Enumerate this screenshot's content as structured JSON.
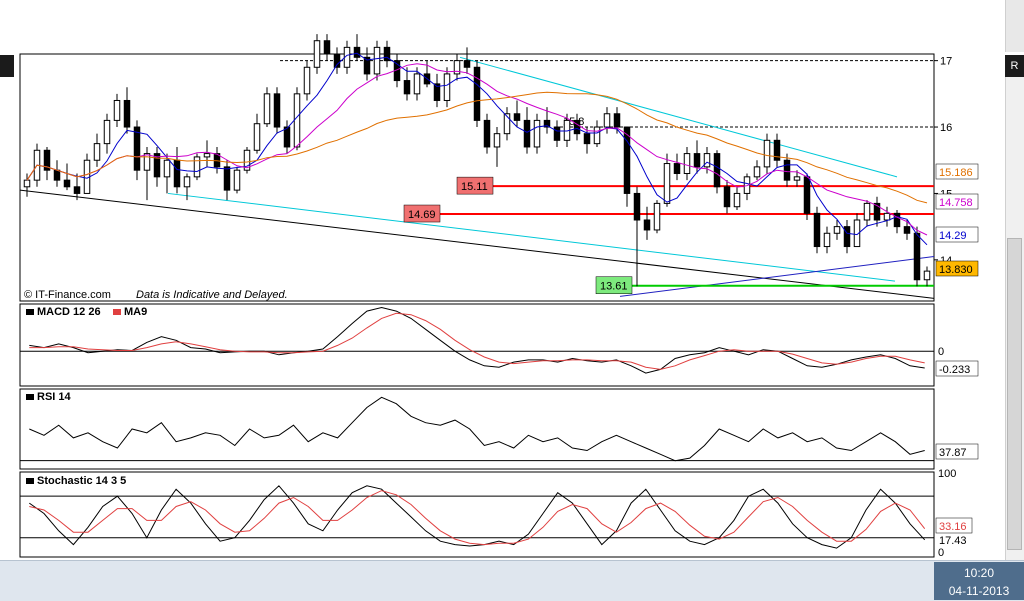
{
  "window": {
    "right_scroll_glyph": "R",
    "watermark": "© IT-Finance.com",
    "disclaimer": "Data is Indicative and Delayed."
  },
  "taskbar": {
    "time": "10:20",
    "date": "04-11-2013"
  },
  "colors": {
    "up_candle": "#ffffff",
    "down_candle": "#000000",
    "sma_fast": "#0000cc",
    "sma_mid": "#cc00cc",
    "sma_slow": "#e07000",
    "resistance": "#ff0000",
    "support": "#00cc00",
    "channel": "#00c8d8",
    "trendline": "#000000",
    "macd": "#000000",
    "macd_signal": "#e04040",
    "stoch_d": "#e04040"
  },
  "chart_data": [
    {
      "type": "candlestick",
      "ylim": [
        13.38,
        17.1
      ],
      "y_ticks": [
        "17",
        "16",
        "15",
        "14"
      ],
      "indicators": {
        "sma_fast": {
          "last": "14.29"
        },
        "sma_mid": {
          "last": "14.758"
        },
        "sma_slow": {
          "last": "15.186"
        }
      },
      "last_price": "13.830",
      "dotted_high_label": "15.8",
      "levels": [
        {
          "value": 15.11,
          "label": "15.11",
          "color": "#ff0000"
        },
        {
          "value": 14.69,
          "label": "14.69",
          "color": "#ff0000"
        },
        {
          "value": 13.61,
          "label": "13.61",
          "color": "#00cc00"
        }
      ],
      "ohlc": [
        [
          15.1,
          15.3,
          14.95,
          15.2
        ],
        [
          15.2,
          15.75,
          15.1,
          15.65
        ],
        [
          15.65,
          15.7,
          15.2,
          15.35
        ],
        [
          15.35,
          15.5,
          15.1,
          15.2
        ],
        [
          15.2,
          15.45,
          15.05,
          15.1
        ],
        [
          15.1,
          15.3,
          14.9,
          15.0
        ],
        [
          15.0,
          15.6,
          15.0,
          15.5
        ],
        [
          15.5,
          15.9,
          15.4,
          15.75
        ],
        [
          15.75,
          16.2,
          15.6,
          16.1
        ],
        [
          16.1,
          16.5,
          16.0,
          16.4
        ],
        [
          16.4,
          16.6,
          15.9,
          16.0
        ],
        [
          16.0,
          16.1,
          15.2,
          15.35
        ],
        [
          15.35,
          15.7,
          14.9,
          15.6
        ],
        [
          15.6,
          15.7,
          15.1,
          15.25
        ],
        [
          15.25,
          15.6,
          15.0,
          15.5
        ],
        [
          15.5,
          15.7,
          15.0,
          15.1
        ],
        [
          15.1,
          15.3,
          14.9,
          15.25
        ],
        [
          15.25,
          15.6,
          15.2,
          15.55
        ],
        [
          15.55,
          15.8,
          15.4,
          15.6
        ],
        [
          15.6,
          15.7,
          15.3,
          15.4
        ],
        [
          15.4,
          15.5,
          14.9,
          15.05
        ],
        [
          15.05,
          15.4,
          15.0,
          15.35
        ],
        [
          15.35,
          15.7,
          15.3,
          15.65
        ],
        [
          15.65,
          16.2,
          15.6,
          16.05
        ],
        [
          16.05,
          16.6,
          16.0,
          16.5
        ],
        [
          16.5,
          16.6,
          15.9,
          16.0
        ],
        [
          16.0,
          16.1,
          15.6,
          15.7
        ],
        [
          15.7,
          16.6,
          15.65,
          16.5
        ],
        [
          16.5,
          17.0,
          16.4,
          16.9
        ],
        [
          16.9,
          17.4,
          16.8,
          17.3
        ],
        [
          17.3,
          17.4,
          17.0,
          17.1
        ],
        [
          17.1,
          17.2,
          16.8,
          16.9
        ],
        [
          16.9,
          17.3,
          16.8,
          17.2
        ],
        [
          17.2,
          17.4,
          17.0,
          17.05
        ],
        [
          17.05,
          17.2,
          16.7,
          16.8
        ],
        [
          16.8,
          17.3,
          16.7,
          17.2
        ],
        [
          17.2,
          17.3,
          16.9,
          17.0
        ],
        [
          17.0,
          17.1,
          16.6,
          16.7
        ],
        [
          16.7,
          16.9,
          16.4,
          16.5
        ],
        [
          16.5,
          16.9,
          16.4,
          16.8
        ],
        [
          16.8,
          17.0,
          16.6,
          16.65
        ],
        [
          16.65,
          16.8,
          16.3,
          16.4
        ],
        [
          16.4,
          16.9,
          16.3,
          16.8
        ],
        [
          16.8,
          17.1,
          16.7,
          17.0
        ],
        [
          17.0,
          17.2,
          16.8,
          16.9
        ],
        [
          16.9,
          17.0,
          16.0,
          16.1
        ],
        [
          16.1,
          16.2,
          15.6,
          15.7
        ],
        [
          15.7,
          16.0,
          15.4,
          15.9
        ],
        [
          15.9,
          16.3,
          15.8,
          16.2
        ],
        [
          16.2,
          16.4,
          16.0,
          16.1
        ],
        [
          16.1,
          16.3,
          15.6,
          15.7
        ],
        [
          15.7,
          16.2,
          15.6,
          16.1
        ],
        [
          16.1,
          16.3,
          15.9,
          16.0
        ],
        [
          16.0,
          16.1,
          15.7,
          15.8
        ],
        [
          15.8,
          16.2,
          15.7,
          16.1
        ],
        [
          16.1,
          16.2,
          15.8,
          15.9
        ],
        [
          15.9,
          16.0,
          15.6,
          15.75
        ],
        [
          15.75,
          16.1,
          15.7,
          16.0
        ],
        [
          16.0,
          16.3,
          15.9,
          16.2
        ],
        [
          16.2,
          16.3,
          15.9,
          16.0
        ],
        [
          16.0,
          16.0,
          14.8,
          15.0
        ],
        [
          15.0,
          15.1,
          13.6,
          14.6
        ],
        [
          14.6,
          14.8,
          14.3,
          14.45
        ],
        [
          14.45,
          14.9,
          14.4,
          14.85
        ],
        [
          14.85,
          15.6,
          14.8,
          15.45
        ],
        [
          15.45,
          15.6,
          15.2,
          15.3
        ],
        [
          15.3,
          15.7,
          15.2,
          15.6
        ],
        [
          15.6,
          15.8,
          15.3,
          15.4
        ],
        [
          15.4,
          15.7,
          15.3,
          15.6
        ],
        [
          15.6,
          15.65,
          15.0,
          15.1
        ],
        [
          15.1,
          15.2,
          14.7,
          14.8
        ],
        [
          14.8,
          15.1,
          14.75,
          15.0
        ],
        [
          15.0,
          15.3,
          14.9,
          15.25
        ],
        [
          15.25,
          15.5,
          15.2,
          15.4
        ],
        [
          15.4,
          15.9,
          15.3,
          15.8
        ],
        [
          15.8,
          15.9,
          15.4,
          15.5
        ],
        [
          15.5,
          15.6,
          15.1,
          15.2
        ],
        [
          15.2,
          15.35,
          15.1,
          15.25
        ],
        [
          15.25,
          15.3,
          14.6,
          14.7
        ],
        [
          14.7,
          14.8,
          14.1,
          14.2
        ],
        [
          14.2,
          14.5,
          14.1,
          14.4
        ],
        [
          14.4,
          14.6,
          14.3,
          14.5
        ],
        [
          14.5,
          14.6,
          14.1,
          14.2
        ],
        [
          14.2,
          14.7,
          14.2,
          14.6
        ],
        [
          14.6,
          14.9,
          14.5,
          14.85
        ],
        [
          14.85,
          14.95,
          14.5,
          14.6
        ],
        [
          14.6,
          14.8,
          14.5,
          14.7
        ],
        [
          14.7,
          14.75,
          14.4,
          14.5
        ],
        [
          14.5,
          14.6,
          14.3,
          14.4
        ],
        [
          14.4,
          14.5,
          13.6,
          13.7
        ],
        [
          13.7,
          13.9,
          13.6,
          13.83
        ]
      ]
    },
    {
      "type": "line",
      "title": "MACD 12 26",
      "legend": [
        "MACD 12 26",
        "MA9"
      ],
      "ylim": [
        -0.45,
        0.62
      ],
      "zero_label": "0",
      "last": "-0.233",
      "series": [
        {
          "name": "MACD 12 26",
          "values": [
            0.08,
            0.05,
            0.1,
            0.05,
            -0.02,
            0.0,
            0.02,
            0.01,
            0.12,
            0.2,
            0.15,
            0.05,
            0.03,
            -0.02,
            -0.01,
            0.0,
            0.0,
            -0.05,
            -0.02,
            0.0,
            0.03,
            0.2,
            0.38,
            0.55,
            0.6,
            0.55,
            0.45,
            0.3,
            0.15,
            0.0,
            -0.12,
            -0.2,
            -0.22,
            -0.15,
            -0.12,
            -0.12,
            -0.15,
            -0.1,
            -0.13,
            -0.15,
            -0.12,
            -0.2,
            -0.3,
            -0.25,
            -0.1,
            -0.05,
            -0.02,
            0.05,
            0.0,
            -0.05,
            0.02,
            0.0,
            -0.1,
            -0.2,
            -0.22,
            -0.18,
            -0.12,
            -0.08,
            -0.05,
            -0.1,
            -0.2,
            -0.23
          ]
        },
        {
          "name": "MA9",
          "values": [
            0.05,
            0.05,
            0.06,
            0.06,
            0.03,
            0.02,
            0.01,
            0.01,
            0.05,
            0.1,
            0.13,
            0.1,
            0.06,
            0.02,
            0.0,
            -0.01,
            -0.01,
            -0.02,
            -0.02,
            -0.01,
            0.0,
            0.08,
            0.18,
            0.32,
            0.45,
            0.52,
            0.5,
            0.42,
            0.3,
            0.15,
            0.02,
            -0.08,
            -0.15,
            -0.17,
            -0.15,
            -0.13,
            -0.13,
            -0.12,
            -0.12,
            -0.13,
            -0.13,
            -0.15,
            -0.22,
            -0.25,
            -0.2,
            -0.12,
            -0.06,
            0.0,
            0.02,
            0.0,
            0.0,
            0.0,
            -0.04,
            -0.1,
            -0.16,
            -0.18,
            -0.15,
            -0.1,
            -0.07,
            -0.07,
            -0.12,
            -0.16
          ]
        }
      ]
    },
    {
      "type": "line",
      "title": "RSI 14",
      "ylim": [
        25,
        85
      ],
      "last": "37.87",
      "series": [
        {
          "name": "RSI 14",
          "values": [
            55,
            50,
            58,
            48,
            52,
            45,
            40,
            55,
            52,
            60,
            45,
            48,
            52,
            50,
            42,
            55,
            48,
            50,
            58,
            45,
            52,
            48,
            60,
            72,
            80,
            75,
            65,
            60,
            58,
            62,
            55,
            42,
            45,
            40,
            50,
            45,
            48,
            40,
            38,
            45,
            50,
            45,
            40,
            35,
            30,
            32,
            42,
            55,
            50,
            45,
            55,
            48,
            52,
            45,
            48,
            40,
            38,
            45,
            52,
            45,
            35,
            38
          ]
        }
      ]
    },
    {
      "type": "line",
      "title": "Stochastic 14 3 5",
      "ylim": [
        -5,
        112
      ],
      "top_label": "100",
      "bottom_label": "0",
      "last_k": "17.43",
      "last_d": "33.16",
      "series": [
        {
          "name": "Stochastic 14 3 5",
          "values": [
            70,
            55,
            30,
            10,
            35,
            65,
            80,
            55,
            20,
            60,
            90,
            70,
            40,
            15,
            20,
            45,
            75,
            95,
            70,
            40,
            30,
            60,
            85,
            95,
            90,
            70,
            50,
            30,
            15,
            10,
            8,
            10,
            15,
            10,
            25,
            55,
            85,
            70,
            40,
            10,
            30,
            70,
            90,
            60,
            30,
            15,
            10,
            20,
            45,
            80,
            90,
            70,
            40,
            20,
            10,
            5,
            20,
            60,
            90,
            70,
            40,
            17
          ]
        },
        {
          "values": [
            65,
            60,
            45,
            28,
            28,
            45,
            62,
            62,
            45,
            45,
            65,
            72,
            60,
            40,
            28,
            30,
            48,
            70,
            78,
            65,
            45,
            45,
            60,
            78,
            88,
            82,
            68,
            48,
            30,
            18,
            12,
            10,
            12,
            12,
            18,
            35,
            58,
            68,
            62,
            40,
            28,
            42,
            62,
            70,
            58,
            38,
            22,
            18,
            28,
            50,
            72,
            78,
            65,
            45,
            28,
            15,
            15,
            32,
            58,
            70,
            60,
            33
          ]
        }
      ]
    }
  ]
}
